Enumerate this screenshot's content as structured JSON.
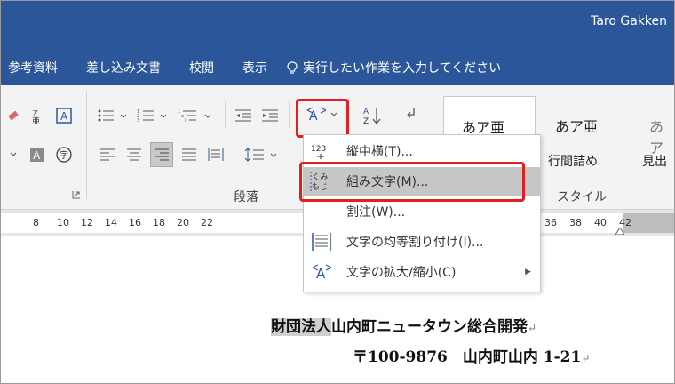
{
  "window": {
    "user_name": "Taro Gakken"
  },
  "tabs": [
    {
      "label": "参考資料"
    },
    {
      "label": "差し込み文書"
    },
    {
      "label": "校閲"
    },
    {
      "label": "表示"
    }
  ],
  "tell_me": {
    "placeholder": "実行したい作業を入力してください"
  },
  "ribbon": {
    "group_paragraph_label": "段落",
    "group_styles_label": "スタイル",
    "sort_label": "A↓Z",
    "styles": [
      {
        "sample": "あア亜",
        "name": ""
      },
      {
        "sample": "あア亜",
        "name": "行間詰め"
      },
      {
        "sample": "あア",
        "name": "見出"
      }
    ]
  },
  "ruler": {
    "ticks": [
      "8",
      "10",
      "12",
      "14",
      "16",
      "18",
      "20",
      "22",
      "",
      "",
      "",
      "",
      "",
      "36",
      "38",
      "40",
      "42"
    ]
  },
  "dropdown": {
    "items": [
      {
        "label": "縦中横(T)...",
        "icon": "tate-chu-yoko-icon"
      },
      {
        "label": "組み文字(M)...",
        "icon": "kumimoji-icon",
        "highlighted": true
      },
      {
        "label": "割注(W)...",
        "icon": "warichu-icon"
      },
      {
        "label": "文字の均等割り付け(I)...",
        "icon": "distribute-text-icon"
      },
      {
        "label": "文字の拡大/縮小(C)",
        "icon": "character-scale-icon",
        "submenu": true
      }
    ]
  },
  "document": {
    "line1_selected": "財団法人",
    "line1_rest": "山内町ニュータウン総合開発",
    "line2": "〒100-9876　山内町山内 1-21",
    "paragraph_mark": "↵"
  },
  "colors": {
    "title_bar": "#2b579a",
    "highlight_border": "#e02020",
    "menu_hover": "#c6c6c6"
  }
}
